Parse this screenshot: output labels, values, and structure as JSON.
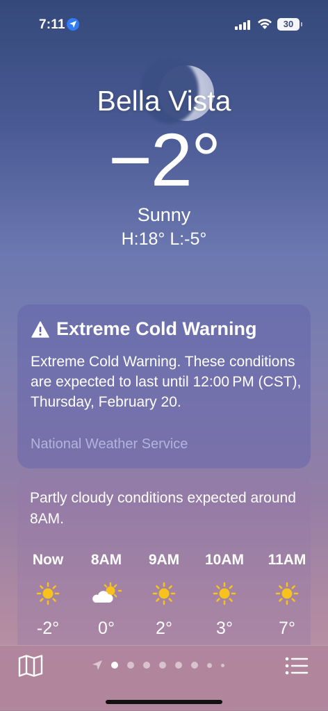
{
  "status_bar": {
    "time": "7:11",
    "battery": "30"
  },
  "location": {
    "city": "Bella Vista",
    "temperature": "−2°",
    "condition": "Sunny",
    "high_low": "H:18°  L:-5°"
  },
  "alert": {
    "title": "Extreme Cold Warning",
    "body": "Extreme Cold Warning. These conditions are expected to last until 12:00 PM (CST), Thursday, February 20.",
    "source": "National Weather Service",
    "icon": "warning-triangle-icon"
  },
  "hourly": {
    "summary": "Partly cloudy conditions expected around 8AM.",
    "items": [
      {
        "label": "Now",
        "icon": "sun-icon",
        "temp": "-2°"
      },
      {
        "label": "8AM",
        "icon": "partly-cloudy-icon",
        "temp": "0°"
      },
      {
        "label": "9AM",
        "icon": "sun-icon",
        "temp": "2°"
      },
      {
        "label": "10AM",
        "icon": "sun-icon",
        "temp": "3°"
      },
      {
        "label": "11AM",
        "icon": "sun-icon",
        "temp": "7°"
      }
    ]
  },
  "colors": {
    "sun": "#f6c21b",
    "accent_blue": "#2f7cf6"
  }
}
